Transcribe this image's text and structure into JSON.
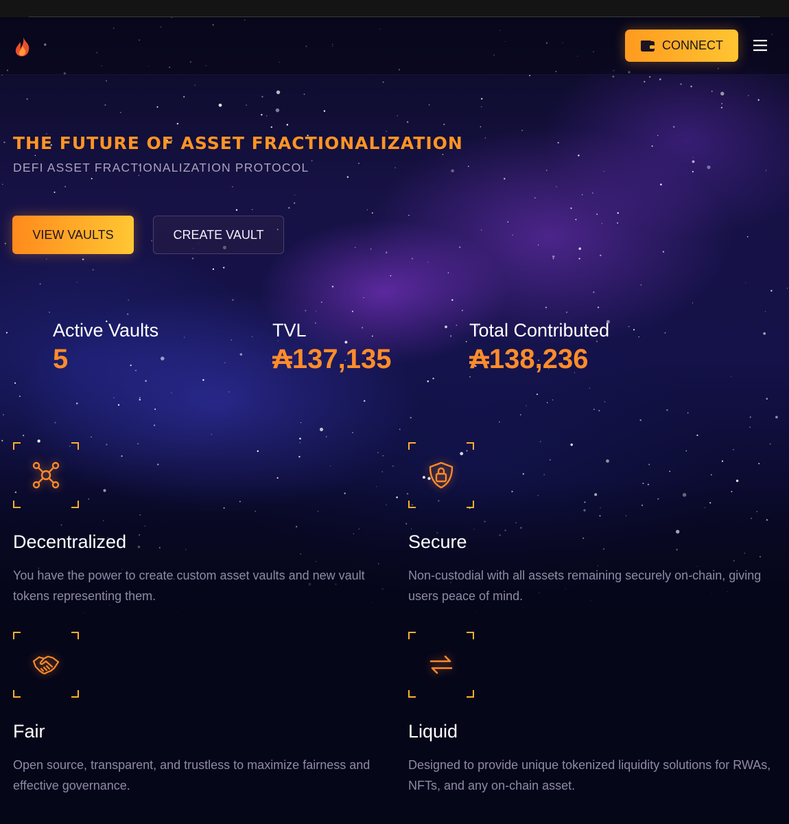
{
  "header": {
    "logo_icon": "flame-logo-icon",
    "connect_label": "CONNECT",
    "wallet_icon": "wallet-icon",
    "menu_icon": "hamburger-menu-icon"
  },
  "hero": {
    "title": "THE FUTURE OF ASSET FRACTIONALIZATION",
    "subtitle": "DEFI ASSET FRACTIONALIZATION PROTOCOL",
    "primary_button": "VIEW VAULTS",
    "secondary_button": "CREATE VAULT"
  },
  "stats": [
    {
      "label": "Active Vaults",
      "value": "5"
    },
    {
      "label": "TVL",
      "value": "₳137,135"
    },
    {
      "label": "Total Contributed",
      "value": "₳138,236"
    }
  ],
  "features": [
    {
      "icon": "network-nodes-icon",
      "title": "Decentralized",
      "description": "You have the power to create custom asset vaults and new vault tokens representing them."
    },
    {
      "icon": "shield-lock-icon",
      "title": "Secure",
      "description": "Non-custodial with all assets remaining securely on-chain, giving users peace of mind."
    },
    {
      "icon": "handshake-icon",
      "title": "Fair",
      "description": "Open source, transparent, and trustless to maximize fairness and effective governance."
    },
    {
      "icon": "swap-arrows-icon",
      "title": "Liquid",
      "description": "Designed to provide unique tokenized liquidity solutions for RWAs, NFTs, and any on-chain asset."
    }
  ],
  "colors": {
    "accent": "#ff9424",
    "accent_gradient_end": "#ffc531",
    "background": "#060619"
  }
}
